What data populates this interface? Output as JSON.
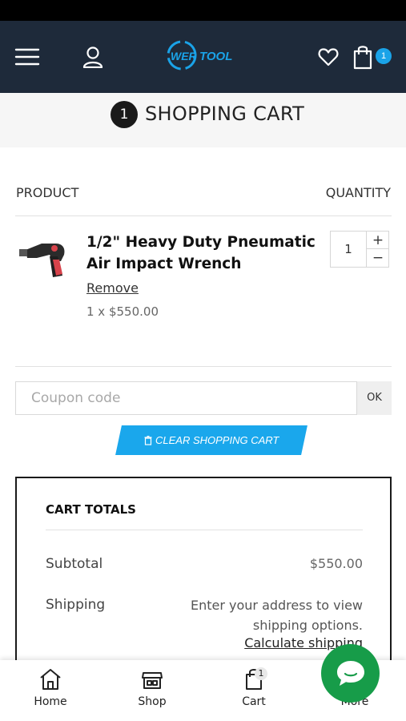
{
  "header": {
    "logo_text": "WER TOOL",
    "cart_badge": "1",
    "icons": [
      "menu-icon",
      "user-icon",
      "heart-icon",
      "shopping-bag-icon"
    ],
    "background": "#1e2a3a",
    "accent": "#1aa3e8"
  },
  "title": {
    "step": "1",
    "text": "SHOPPING CART"
  },
  "cart": {
    "col_product": "PRODUCT",
    "col_quantity": "QUANTITY",
    "items": [
      {
        "name": "1/2\" Heavy Duty Pneumatic Air Impact Wrench",
        "remove_label": "Remove",
        "price_line": "1 x $550.00",
        "quantity": "1",
        "plus": "+",
        "minus": "−"
      }
    ]
  },
  "coupon": {
    "placeholder": "Coupon code",
    "ok_label": "OK"
  },
  "clear_cart": {
    "label": "CLEAR SHOPPING CART"
  },
  "totals": {
    "title": "CART TOTALS",
    "subtotal_label": "Subtotal",
    "subtotal_value": "$550.00",
    "shipping_label": "Shipping",
    "shipping_text": "Enter your address to view shipping options.",
    "calculate_link": "Calculate shipping"
  },
  "bottom_nav": {
    "items": [
      {
        "label": "Home",
        "icon": "home-icon"
      },
      {
        "label": "Shop",
        "icon": "shop-icon"
      },
      {
        "label": "Cart",
        "icon": "cart-icon",
        "count": "1"
      },
      {
        "label": "More",
        "icon": "more-icon"
      }
    ]
  },
  "chat": {
    "icon": "chat-icon",
    "color": "#179c49"
  }
}
